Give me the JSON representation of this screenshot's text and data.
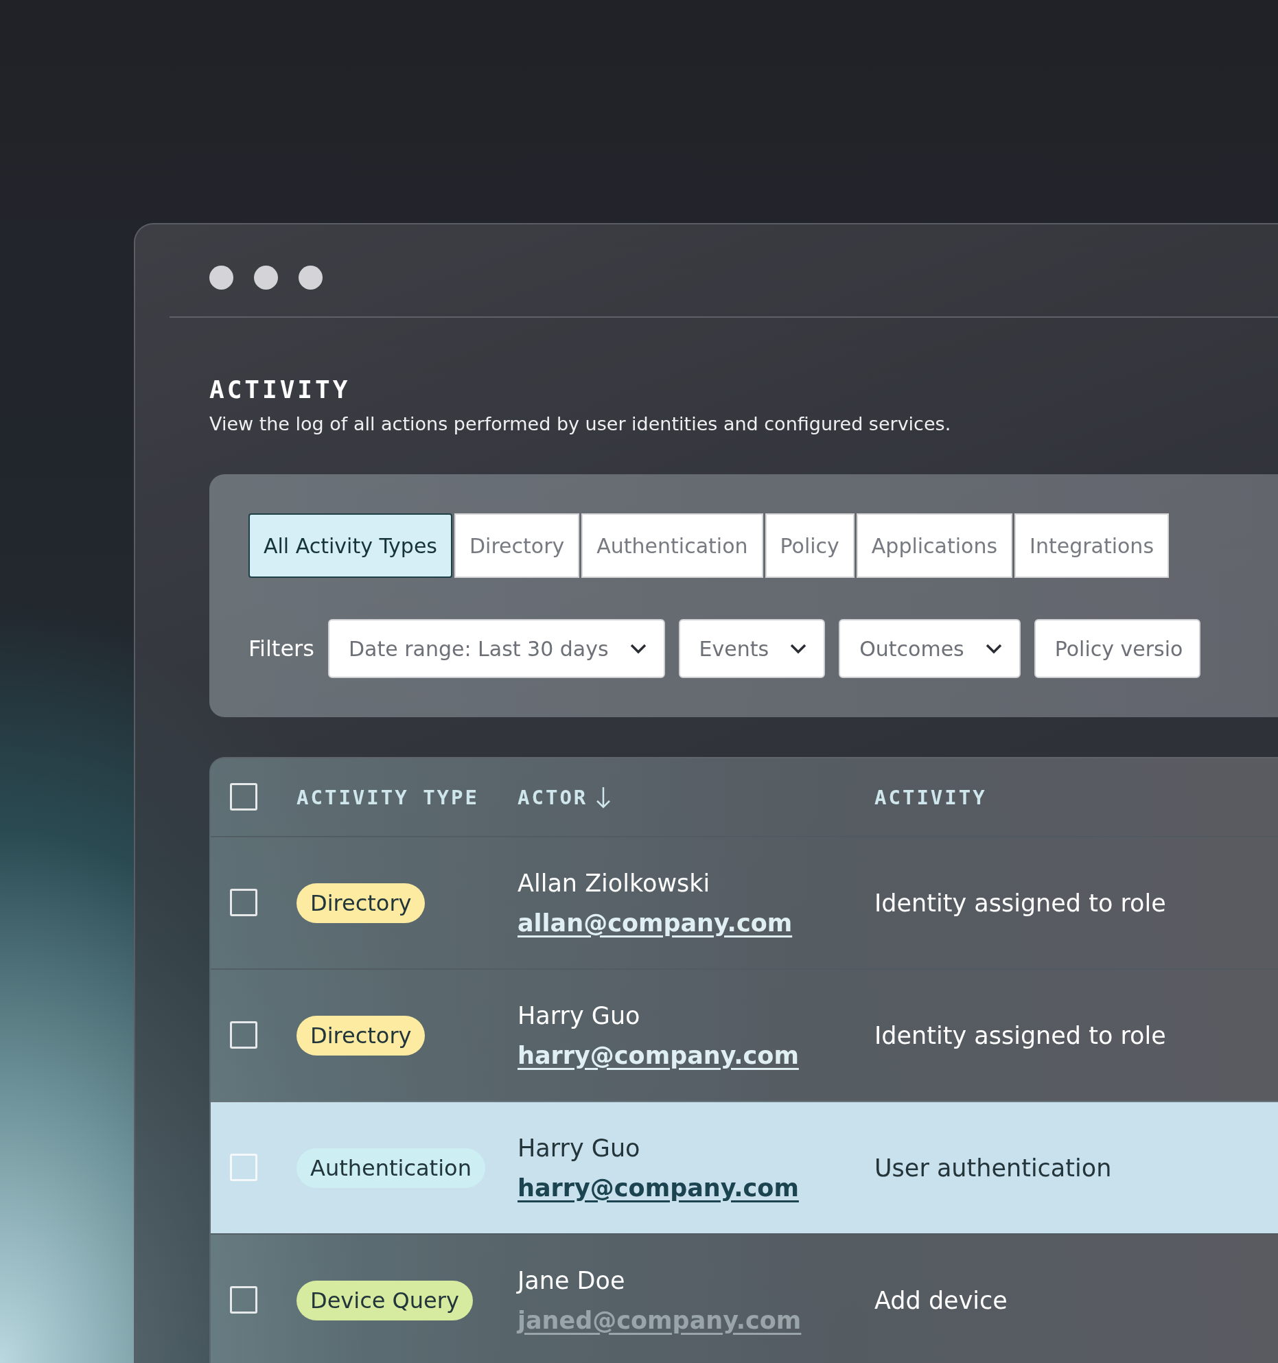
{
  "window": {
    "title": "ACTIVITY",
    "subtitle": "View the log of all actions performed by user identities and configured services."
  },
  "tabs": [
    {
      "label": "All Activity Types",
      "selected": true
    },
    {
      "label": "Directory",
      "selected": false
    },
    {
      "label": "Authentication",
      "selected": false
    },
    {
      "label": "Policy",
      "selected": false
    },
    {
      "label": "Applications",
      "selected": false
    },
    {
      "label": "Integrations",
      "selected": false
    }
  ],
  "filters": {
    "label": "Filters",
    "items": [
      {
        "label": "Date range: Last 30 days",
        "caret": true
      },
      {
        "label": "Events",
        "caret": true
      },
      {
        "label": "Outcomes",
        "caret": true
      },
      {
        "label": "Policy versio",
        "caret": false
      }
    ]
  },
  "table": {
    "header_checked": false,
    "columns": [
      {
        "label": "ACTIVITY TYPE",
        "sorted": false
      },
      {
        "label": "ACTOR",
        "sorted": true
      },
      {
        "label": "ACTIVITY",
        "sorted": false
      }
    ],
    "rows": [
      {
        "checked": false,
        "selected": false,
        "type": "Directory",
        "color": "#fdeba1",
        "name": "Allan Ziolkowski",
        "email": "allan@company.com",
        "email_disabled": false,
        "activity": "Identity assigned to role"
      },
      {
        "checked": false,
        "selected": false,
        "type": "Directory",
        "color": "#fdeba1",
        "name": "Harry Guo",
        "email": "harry@company.com",
        "email_disabled": false,
        "activity": "Identity assigned to role"
      },
      {
        "checked": false,
        "selected": true,
        "type": "Authentication",
        "color": "#cdeff3",
        "name": "Harry Guo",
        "email": "harry@company.com",
        "email_disabled": false,
        "activity": "User authentication"
      },
      {
        "checked": false,
        "selected": false,
        "type": "Device Query",
        "color": "#d6eaa0",
        "name": "Jane Doe",
        "email": "janed@company.com",
        "email_disabled": true,
        "activity": "Add device"
      }
    ]
  }
}
